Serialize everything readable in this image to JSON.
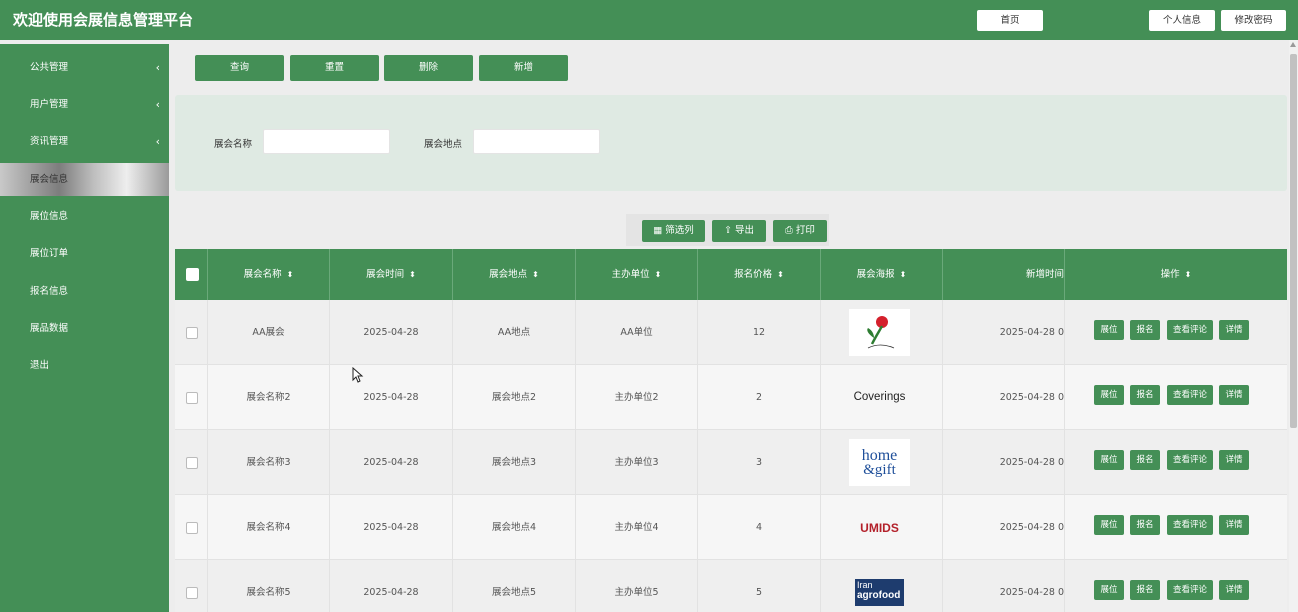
{
  "header": {
    "title": "欢迎使用会展信息管理平台",
    "home_label": "首页",
    "profile_label": "个人信息",
    "password_label": "修改密码",
    "bg_color": "#448f56"
  },
  "sidebar": {
    "items": [
      {
        "label": "公共管理",
        "has_submenu": true
      },
      {
        "label": "用户管理",
        "has_submenu": true
      },
      {
        "label": "资讯管理",
        "has_submenu": true
      },
      {
        "label": "展会信息",
        "active": true
      },
      {
        "label": "展位信息"
      },
      {
        "label": "展位订单"
      },
      {
        "label": "报名信息"
      },
      {
        "label": "展品数据"
      },
      {
        "label": "退出"
      }
    ],
    "chevron": "‹"
  },
  "actions": {
    "query": "查询",
    "reset": "重置",
    "delete": "删除",
    "add": "新增"
  },
  "search": {
    "name_label": "展会名称",
    "name_value": "",
    "location_label": "展会地点",
    "location_value": ""
  },
  "toolbar": {
    "filter_cols": "筛选列",
    "export": "导出",
    "print": "打印"
  },
  "table": {
    "columns": [
      "展会名称",
      "展会时间",
      "展会地点",
      "主办单位",
      "报名价格",
      "展会海报",
      "新增时间",
      "操作"
    ],
    "rows": [
      {
        "name": "AA展会",
        "date": "2025-04-28",
        "location": "AA地点",
        "organizer": "AA单位",
        "price": "12",
        "poster": "flower-logo",
        "added": "2025-04-28 0"
      },
      {
        "name": "展会名称2",
        "date": "2025-04-28",
        "location": "展会地点2",
        "organizer": "主办单位2",
        "price": "2",
        "poster": "Coverings",
        "added": "2025-04-28 0"
      },
      {
        "name": "展会名称3",
        "date": "2025-04-28",
        "location": "展会地点3",
        "organizer": "主办单位3",
        "price": "3",
        "poster": "home & gift",
        "added": "2025-04-28 0"
      },
      {
        "name": "展会名称4",
        "date": "2025-04-28",
        "location": "展会地点4",
        "organizer": "主办单位4",
        "price": "4",
        "poster": "UMIDS",
        "added": "2025-04-28 0"
      },
      {
        "name": "展会名称5",
        "date": "2025-04-28",
        "location": "展会地点5",
        "organizer": "主办单位5",
        "price": "5",
        "poster": "Iran agrofood",
        "added": "2025-04-28 0"
      }
    ],
    "row_actions": {
      "booth": "展位",
      "signup": "报名",
      "comments": "查看评论",
      "detail": "详情"
    },
    "poster_texts": {
      "coverings": "Coverings",
      "home_line1": "home",
      "home_line2": "&gift",
      "umids": "UMIDS",
      "iran_line1": "Iran",
      "iran_line2": "agrofood"
    }
  }
}
